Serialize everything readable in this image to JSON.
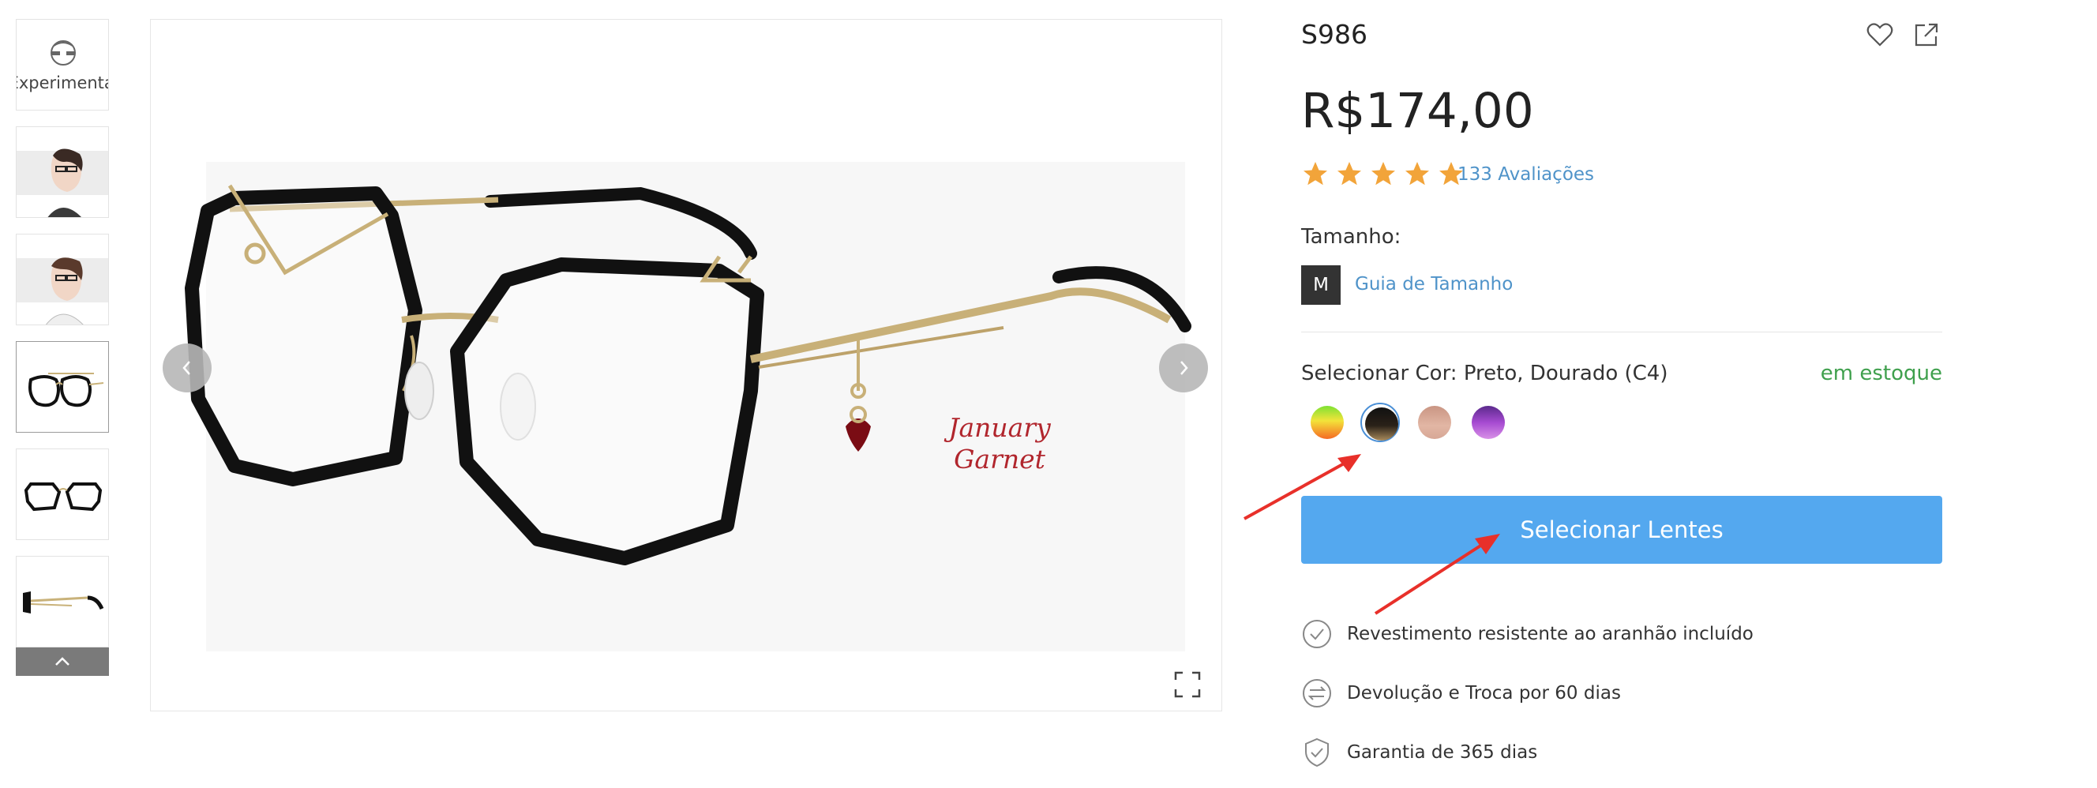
{
  "thumbnails": {
    "try_on_label": "Experimentar",
    "items": [
      "try-on",
      "model-1",
      "model-2",
      "front-angled",
      "front",
      "side"
    ]
  },
  "main_image": {
    "charm_line1": "January",
    "charm_line2": "Garnet"
  },
  "product": {
    "title": "S986",
    "price": "R$174,00",
    "rating_stars": 5,
    "reviews_label": "133 Avaliações",
    "size_label": "Tamanho:",
    "size_value": "M",
    "size_guide_label": "Guia de Tamanho",
    "color_label": "Selecionar Cor: Preto, Dourado (C4)",
    "stock_label": "em estoque",
    "select_lenses_label": "Selecionar Lentes",
    "swatches": [
      {
        "name": "multicolor",
        "selected": false
      },
      {
        "name": "black-gold",
        "selected": true
      },
      {
        "name": "pink",
        "selected": false
      },
      {
        "name": "purple",
        "selected": false
      }
    ],
    "features": [
      "Revestimento resistente ao aranhão incluído",
      "Devolução e Troca por 60 dias",
      "Garantia de 365 dias"
    ]
  },
  "colors": {
    "accent_blue": "#54a8ef",
    "link_blue": "#4f93c9",
    "stock_green": "#3fa04d",
    "star_orange": "#f2a43a",
    "annotation_red": "#e8302a"
  }
}
